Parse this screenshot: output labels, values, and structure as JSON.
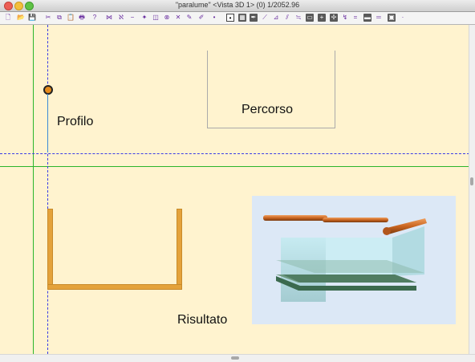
{
  "window": {
    "title": "\"paralume\" <Vista 3D 1> (0) 1/2052.96"
  },
  "toolbar": {
    "buttons": [
      {
        "name": "new-file-icon",
        "glyph": "🗋"
      },
      {
        "name": "open-folder-icon",
        "glyph": "📂"
      },
      {
        "name": "save-icon",
        "glyph": "💾"
      },
      {
        "name": "cut-icon",
        "glyph": "✂"
      },
      {
        "name": "copy-icon",
        "glyph": "⧉"
      },
      {
        "name": "paste-icon",
        "glyph": "📋"
      },
      {
        "name": "print-icon",
        "glyph": "🖶"
      },
      {
        "name": "help-icon",
        "glyph": "?"
      },
      {
        "name": "tool-1-icon",
        "glyph": "⋈"
      },
      {
        "name": "tool-2-icon",
        "glyph": "ℵ"
      },
      {
        "name": "tool-3-icon",
        "glyph": "−"
      },
      {
        "name": "tool-4-icon",
        "glyph": "✦"
      },
      {
        "name": "tool-5-icon",
        "glyph": "◫"
      },
      {
        "name": "tool-6-icon",
        "glyph": "⊗"
      },
      {
        "name": "tool-7-icon",
        "glyph": "✕"
      },
      {
        "name": "tool-8-icon",
        "glyph": "✎"
      },
      {
        "name": "tool-9-icon",
        "glyph": "✐"
      },
      {
        "name": "tool-10-icon",
        "glyph": "•"
      },
      {
        "name": "point-snap-icon",
        "glyph": "•"
      },
      {
        "name": "grid-icon",
        "glyph": "▦"
      },
      {
        "name": "tool-13-icon",
        "glyph": "✒"
      },
      {
        "name": "tool-14-icon",
        "glyph": "⟋"
      },
      {
        "name": "tool-15-icon",
        "glyph": "⊿"
      },
      {
        "name": "tool-16-icon",
        "glyph": "⫽"
      },
      {
        "name": "tool-17-icon",
        "glyph": "≒"
      },
      {
        "name": "tool-18-icon",
        "glyph": "▭"
      },
      {
        "name": "tool-19-icon",
        "glyph": "+"
      },
      {
        "name": "tool-20-icon",
        "glyph": "✢"
      },
      {
        "name": "tool-21-icon",
        "glyph": "↯"
      },
      {
        "name": "tool-22-icon",
        "glyph": "="
      },
      {
        "name": "tool-23-icon",
        "glyph": "▬"
      },
      {
        "name": "tool-24-icon",
        "glyph": "═"
      },
      {
        "name": "tool-25-icon",
        "glyph": "▣"
      },
      {
        "name": "tool-26-icon",
        "glyph": "·"
      }
    ]
  },
  "canvas": {
    "labels": {
      "profilo": "Profilo",
      "percorso": "Percorso",
      "risultato": "Risultato"
    },
    "colors": {
      "background": "#fff3cf",
      "guide_green": "#2bb52b",
      "guide_blue": "#3a3ae6",
      "profile_orange": "#e4a23b"
    }
  }
}
